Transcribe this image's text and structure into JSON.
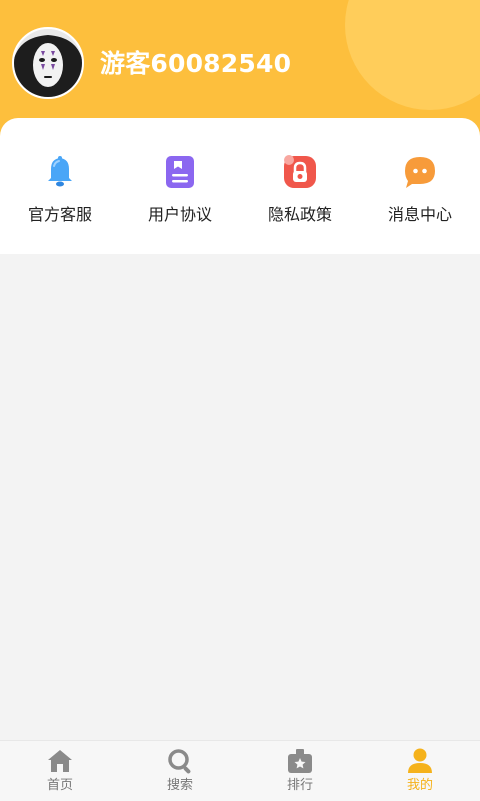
{
  "header": {
    "username": "游客60082540",
    "avatar_icon": "no-face-mask-avatar",
    "background_color": "#fdbf3d"
  },
  "menu": {
    "items": [
      {
        "label": "官方客服",
        "icon": "bell-icon",
        "color": "#4aa6f7"
      },
      {
        "label": "用户协议",
        "icon": "document-icon",
        "color": "#8b67f0"
      },
      {
        "label": "隐私政策",
        "icon": "privacy-lock-icon",
        "color": "#f0574b"
      },
      {
        "label": "消息中心",
        "icon": "chat-bubble-icon",
        "color": "#f79b3a"
      }
    ]
  },
  "bottom_nav": {
    "items": [
      {
        "label": "首页",
        "icon": "home-icon",
        "active": false
      },
      {
        "label": "搜索",
        "icon": "search-icon",
        "active": false
      },
      {
        "label": "排行",
        "icon": "ranking-icon",
        "active": false
      },
      {
        "label": "我的",
        "icon": "user-icon",
        "active": true
      }
    ],
    "active_color": "#f5b21b",
    "inactive_color": "#8a8a8a"
  }
}
